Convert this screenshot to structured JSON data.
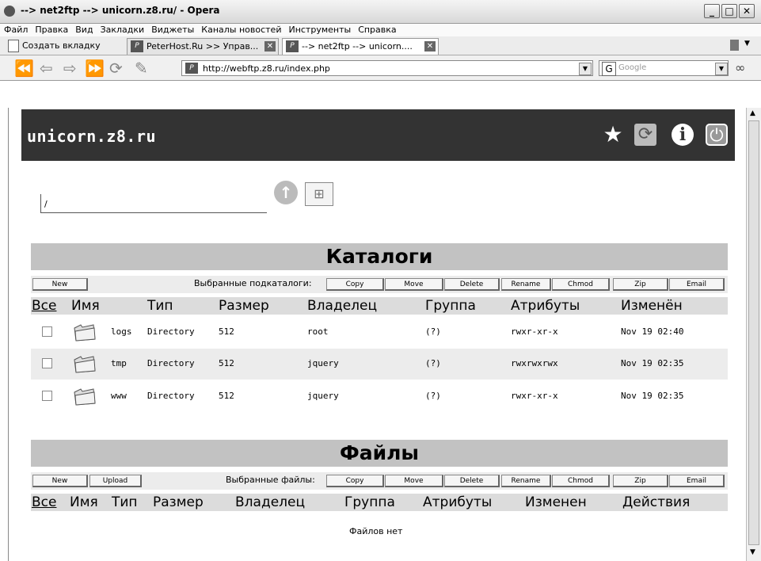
{
  "window": {
    "title": "--> net2ftp --> unicorn.z8.ru/ - Opera"
  },
  "menu": [
    "Файл",
    "Правка",
    "Вид",
    "Закладки",
    "Виджеты",
    "Каналы новостей",
    "Инструменты",
    "Справка"
  ],
  "tabs": [
    {
      "label": "Создать вкладку"
    },
    {
      "label": "PeterHost.Ru >> Управ..."
    },
    {
      "label": "--> net2ftp --> unicorn...."
    }
  ],
  "address": {
    "url": "http://webftp.z8.ru/index.php",
    "search_placeholder": "Google"
  },
  "site": {
    "brand": "unicorn.z8.ru"
  },
  "path": {
    "value": "/"
  },
  "dirs": {
    "title": "Каталоги",
    "new_label": "New",
    "selected_label": "Выбранные подкаталоги:",
    "actions": [
      "Copy",
      "Move",
      "Delete",
      "Rename",
      "Chmod",
      "Zip",
      "Email"
    ],
    "columns": [
      "Все",
      "Имя",
      "Тип",
      "Размер",
      "Владелец",
      "Группа",
      "Атрибуты",
      "Изменён"
    ],
    "rows": [
      {
        "name": "logs",
        "type": "Directory",
        "size": "512",
        "owner": "root",
        "group": "(?)",
        "attrs": "rwxr-xr-x",
        "modified": "Nov 19 02:40"
      },
      {
        "name": "tmp",
        "type": "Directory",
        "size": "512",
        "owner": "jquery",
        "group": "(?)",
        "attrs": "rwxrwxrwx",
        "modified": "Nov 19 02:35"
      },
      {
        "name": "www",
        "type": "Directory",
        "size": "512",
        "owner": "jquery",
        "group": "(?)",
        "attrs": "rwxr-xr-x",
        "modified": "Nov 19 02:35"
      }
    ]
  },
  "files": {
    "title": "Файлы",
    "new_label": "New",
    "upload_label": "Upload",
    "selected_label": "Выбранные файлы:",
    "actions": [
      "Copy",
      "Move",
      "Delete",
      "Rename",
      "Chmod",
      "Zip",
      "Email"
    ],
    "columns": [
      "Все",
      "Имя",
      "Тип",
      "Размер",
      "Владелец",
      "Группа",
      "Атрибуты",
      "Изменен",
      "Действия"
    ],
    "empty": "Файлов нет"
  }
}
